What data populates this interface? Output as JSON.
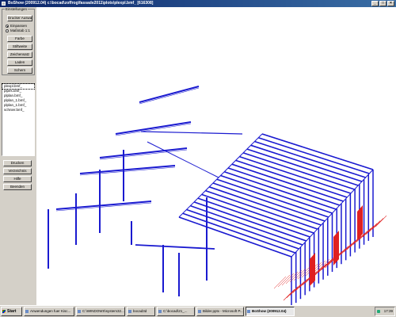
{
  "window": {
    "title": "BoShow (200912.04)  c:\\bocad\\zoffrog\\fassade2011\\plots\\plexpl.bmf_  [616308]"
  },
  "settings": {
    "group_label": "Einstellungen",
    "buttons": {
      "select_printer": "Drucker Auswahl",
      "color": "Farbe",
      "line_width": "Stiftweite",
      "charset": "Zeichensatz",
      "load": "Laden",
      "save": "Schern"
    },
    "radio_options": [
      {
        "label": "Einpassen",
        "checked": true
      },
      {
        "label": "Maßstab 1:1",
        "checked": false
      }
    ]
  },
  "file_list": [
    "plexpl.bmf_",
    "plpes.bmf_",
    "plplan.bmf_",
    "plplan_1.bmf_",
    "plplan_1.bmf_",
    "schnier.bmf_"
  ],
  "actions": {
    "print": "Drucken",
    "directory": "Verzeichnis",
    "help": "Hilfe",
    "exit": "Beenden"
  },
  "taskbar": {
    "start_label": "Start",
    "tasks": [
      {
        "label": "Anwendungen fuer Kisc...",
        "active": false
      },
      {
        "label": "C:\\WINDOWS\\system32...",
        "active": false
      },
      {
        "label": "bocad3d",
        "active": false
      },
      {
        "label": "C:\\bocad\\21_...",
        "active": false
      },
      {
        "label": "Bilder.pptx - Microsoft P...",
        "active": false
      },
      {
        "label": "BoShow (200912.04)",
        "active": true
      }
    ],
    "clock": "17:39"
  },
  "colors": {
    "title_bar": "#0a246a",
    "steel_members": "#1a1ad0",
    "dimension_lines": "#e02020",
    "window_bg": "#d4d0c8"
  },
  "icons": [
    "app-icon",
    "minimize-icon",
    "maximize-icon",
    "close-icon",
    "windows-flag-icon",
    "tray-icon"
  ]
}
